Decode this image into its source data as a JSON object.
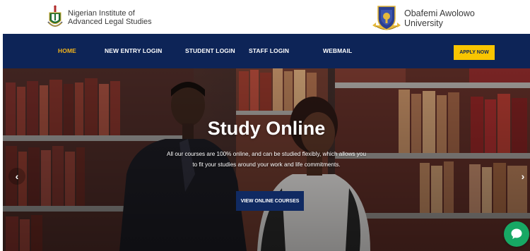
{
  "header": {
    "left_brand": {
      "line1": "Nigerian Institute of",
      "line2": "Advanced Legal Studies",
      "logo_icon": "nials-crest-icon"
    },
    "right_brand": {
      "line1": "Obafemi Awolowo",
      "line2": "University",
      "logo_icon": "oau-shield-icon"
    }
  },
  "nav": {
    "items": [
      {
        "label": "HOME",
        "active": true
      },
      {
        "label": "NEW ENTRY LOGIN",
        "active": false
      },
      {
        "label": "STUDENT LOGIN",
        "active": false
      },
      {
        "label": "STAFF LOGIN",
        "active": false
      },
      {
        "label": "WEBMAIL",
        "active": false
      }
    ],
    "apply_label": "APPLY NOW"
  },
  "hero": {
    "title": "Study Online",
    "subtitle_line1": "All our courses are 100% online, and can be studied flexibly, which allows you",
    "subtitle_line2": "to fit your studies around your work and life commitments.",
    "cta_label": "VIEW ONLINE COURSES",
    "prev_arrow": "‹",
    "next_arrow": "›"
  },
  "chat": {
    "icon": "chat-bubble-icon"
  },
  "colors": {
    "nav_background": "#0d2457",
    "nav_active": "#f3b41b",
    "apply_button": "#f9c500",
    "cta_button": "#102a62",
    "chat_button": "#17a864"
  }
}
